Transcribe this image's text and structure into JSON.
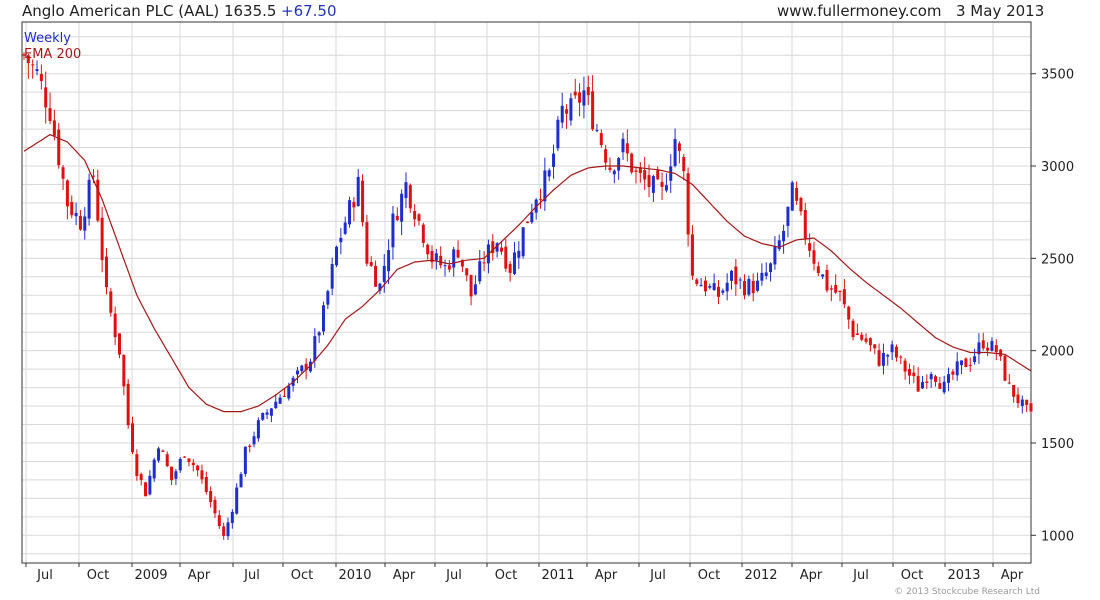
{
  "header": {
    "title": "Anglo American PLC (AAL) 1635.5",
    "change": "+67.50",
    "source": "www.fullermoney.com",
    "date": "3 May 2013"
  },
  "legend": {
    "weekly": "Weekly",
    "ema": "EMA 200"
  },
  "copyright": "© 2013 Stockcube Research Ltd",
  "colors": {
    "up": "#1f2dcc",
    "down": "#e01010",
    "ema": "#a31818",
    "grid": "#d9d9d9"
  },
  "chart_data": {
    "type": "candlestick",
    "timeframe": "weekly",
    "x_tick_labels": [
      "Jul",
      "Oct",
      "2009",
      "Apr",
      "Jul",
      "Oct",
      "2010",
      "Apr",
      "Jul",
      "Oct",
      "2011",
      "Apr",
      "Jul",
      "Oct",
      "2012",
      "Apr",
      "Jul",
      "Oct",
      "2013",
      "Apr"
    ],
    "y_tick_labels": [
      "1000",
      "1500",
      "2000",
      "2500",
      "3000",
      "3500"
    ],
    "ylim": [
      850,
      3780
    ],
    "grid": true,
    "legend_position": "top-left",
    "series": [
      {
        "name": "Weekly",
        "kind": "candlestick"
      },
      {
        "name": "EMA 200",
        "kind": "line"
      }
    ],
    "close_points": [
      [
        0,
        3600
      ],
      [
        3,
        3500
      ],
      [
        6,
        3300
      ],
      [
        10,
        2800
      ],
      [
        13,
        2700
      ],
      [
        16,
        2950
      ],
      [
        19,
        2300
      ],
      [
        22,
        2000
      ],
      [
        24,
        1600
      ],
      [
        26,
        1350
      ],
      [
        28,
        1230
      ],
      [
        31,
        1500
      ],
      [
        34,
        1300
      ],
      [
        37,
        1450
      ],
      [
        40,
        1350
      ],
      [
        43,
        1180
      ],
      [
        46,
        990
      ],
      [
        48,
        1150
      ],
      [
        51,
        1450
      ],
      [
        54,
        1600
      ],
      [
        57,
        1700
      ],
      [
        60,
        1780
      ],
      [
        63,
        1860
      ],
      [
        66,
        1960
      ],
      [
        69,
        2200
      ],
      [
        72,
        2550
      ],
      [
        74,
        2700
      ],
      [
        77,
        2900
      ],
      [
        79,
        2500
      ],
      [
        82,
        2350
      ],
      [
        85,
        2700
      ],
      [
        88,
        2900
      ],
      [
        91,
        2700
      ],
      [
        94,
        2500
      ],
      [
        97,
        2450
      ],
      [
        100,
        2550
      ],
      [
        103,
        2300
      ],
      [
        106,
        2500
      ],
      [
        109,
        2600
      ],
      [
        112,
        2450
      ],
      [
        115,
        2650
      ],
      [
        118,
        2850
      ],
      [
        121,
        2950
      ],
      [
        124,
        3300
      ],
      [
        126,
        3300
      ],
      [
        129,
        3400
      ],
      [
        132,
        3200
      ],
      [
        135,
        3000
      ],
      [
        138,
        3100
      ],
      [
        141,
        2950
      ],
      [
        144,
        2900
      ],
      [
        147,
        2850
      ],
      [
        150,
        3150
      ],
      [
        152,
        2950
      ],
      [
        154,
        2400
      ],
      [
        157,
        2350
      ],
      [
        160,
        2300
      ],
      [
        163,
        2400
      ],
      [
        166,
        2350
      ],
      [
        169,
        2350
      ],
      [
        172,
        2450
      ],
      [
        175,
        2650
      ],
      [
        177,
        2850
      ],
      [
        179,
        2700
      ],
      [
        182,
        2500
      ],
      [
        185,
        2350
      ],
      [
        188,
        2300
      ],
      [
        191,
        2100
      ],
      [
        194,
        2050
      ],
      [
        197,
        1950
      ],
      [
        200,
        2000
      ],
      [
        203,
        1900
      ],
      [
        206,
        1800
      ],
      [
        209,
        1900
      ],
      [
        212,
        1800
      ],
      [
        215,
        1900
      ],
      [
        218,
        1950
      ],
      [
        221,
        2050
      ],
      [
        224,
        2000
      ],
      [
        227,
        1800
      ],
      [
        230,
        1700
      ],
      [
        232,
        1640
      ]
    ],
    "ema200_points": [
      [
        0,
        3080
      ],
      [
        6,
        3170
      ],
      [
        10,
        3130
      ],
      [
        14,
        3030
      ],
      [
        18,
        2820
      ],
      [
        22,
        2560
      ],
      [
        26,
        2300
      ],
      [
        30,
        2120
      ],
      [
        34,
        1960
      ],
      [
        38,
        1800
      ],
      [
        42,
        1710
      ],
      [
        46,
        1670
      ],
      [
        50,
        1670
      ],
      [
        54,
        1700
      ],
      [
        58,
        1760
      ],
      [
        62,
        1830
      ],
      [
        66,
        1920
      ],
      [
        70,
        2030
      ],
      [
        74,
        2170
      ],
      [
        78,
        2240
      ],
      [
        82,
        2330
      ],
      [
        86,
        2440
      ],
      [
        90,
        2480
      ],
      [
        94,
        2490
      ],
      [
        98,
        2470
      ],
      [
        102,
        2490
      ],
      [
        106,
        2500
      ],
      [
        110,
        2590
      ],
      [
        114,
        2680
      ],
      [
        118,
        2780
      ],
      [
        122,
        2870
      ],
      [
        126,
        2950
      ],
      [
        130,
        2990
      ],
      [
        134,
        3000
      ],
      [
        138,
        3000
      ],
      [
        142,
        2990
      ],
      [
        146,
        2980
      ],
      [
        150,
        2960
      ],
      [
        154,
        2900
      ],
      [
        158,
        2800
      ],
      [
        162,
        2700
      ],
      [
        166,
        2620
      ],
      [
        170,
        2580
      ],
      [
        174,
        2560
      ],
      [
        178,
        2600
      ],
      [
        182,
        2610
      ],
      [
        186,
        2540
      ],
      [
        190,
        2450
      ],
      [
        194,
        2370
      ],
      [
        198,
        2300
      ],
      [
        202,
        2230
      ],
      [
        206,
        2150
      ],
      [
        210,
        2070
      ],
      [
        214,
        2020
      ],
      [
        218,
        1990
      ],
      [
        222,
        1990
      ],
      [
        226,
        1980
      ],
      [
        230,
        1920
      ],
      [
        232,
        1890
      ]
    ],
    "n_weeks": 233
  }
}
